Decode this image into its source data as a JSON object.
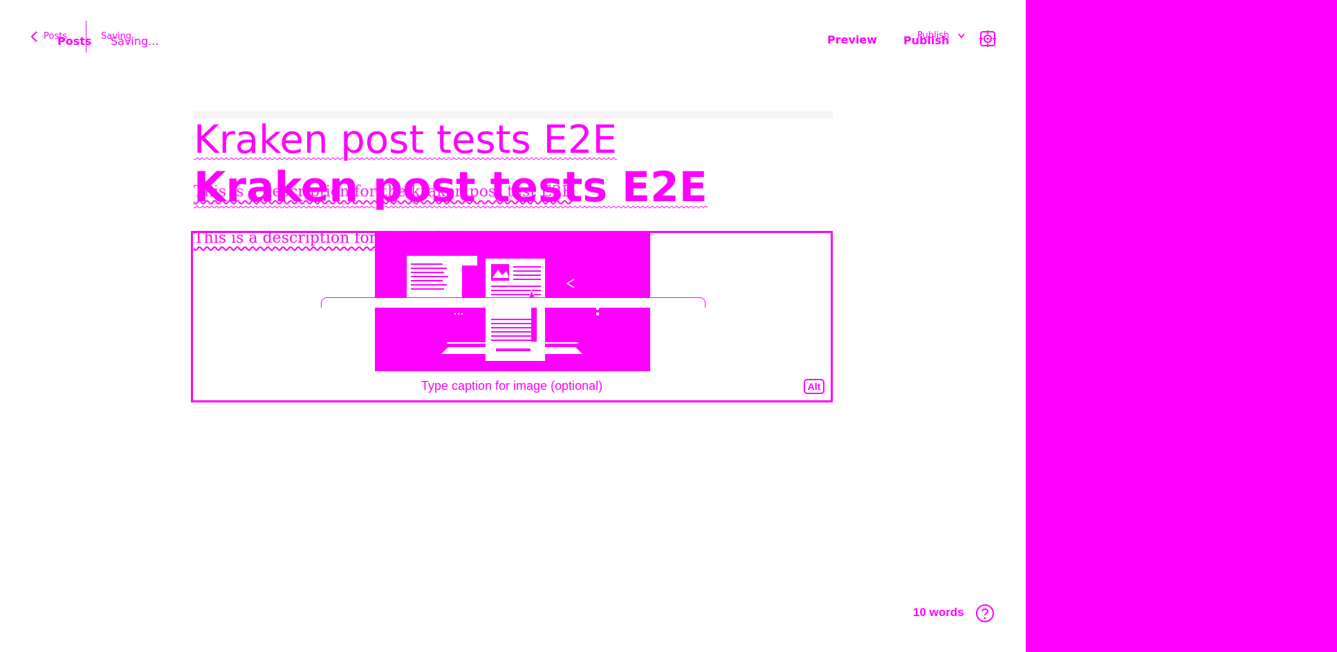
{
  "header": {
    "back_label": "Posts",
    "back_label_ghost": "Posts",
    "status_text": "Saving...",
    "status_ghost": "Saving",
    "preview_label": "Preview",
    "publish_label": "Publish",
    "publish_ghost": "Publish"
  },
  "editor": {
    "title": "Kraken post tests E2E",
    "title_ghost": "Kraken post tests E2E",
    "description": "This is a description for the kraken post test",
    "description_ghost": "This is a description for the kraken post test E2E"
  },
  "image_card": {
    "caption_placeholder": "Type caption for image (optional)",
    "alt_label": "Alt"
  },
  "footer": {
    "word_count": "10 words",
    "help_icon": "help-icon"
  },
  "colors": {
    "accent": "#ff00ff",
    "background": "#ffffff"
  }
}
